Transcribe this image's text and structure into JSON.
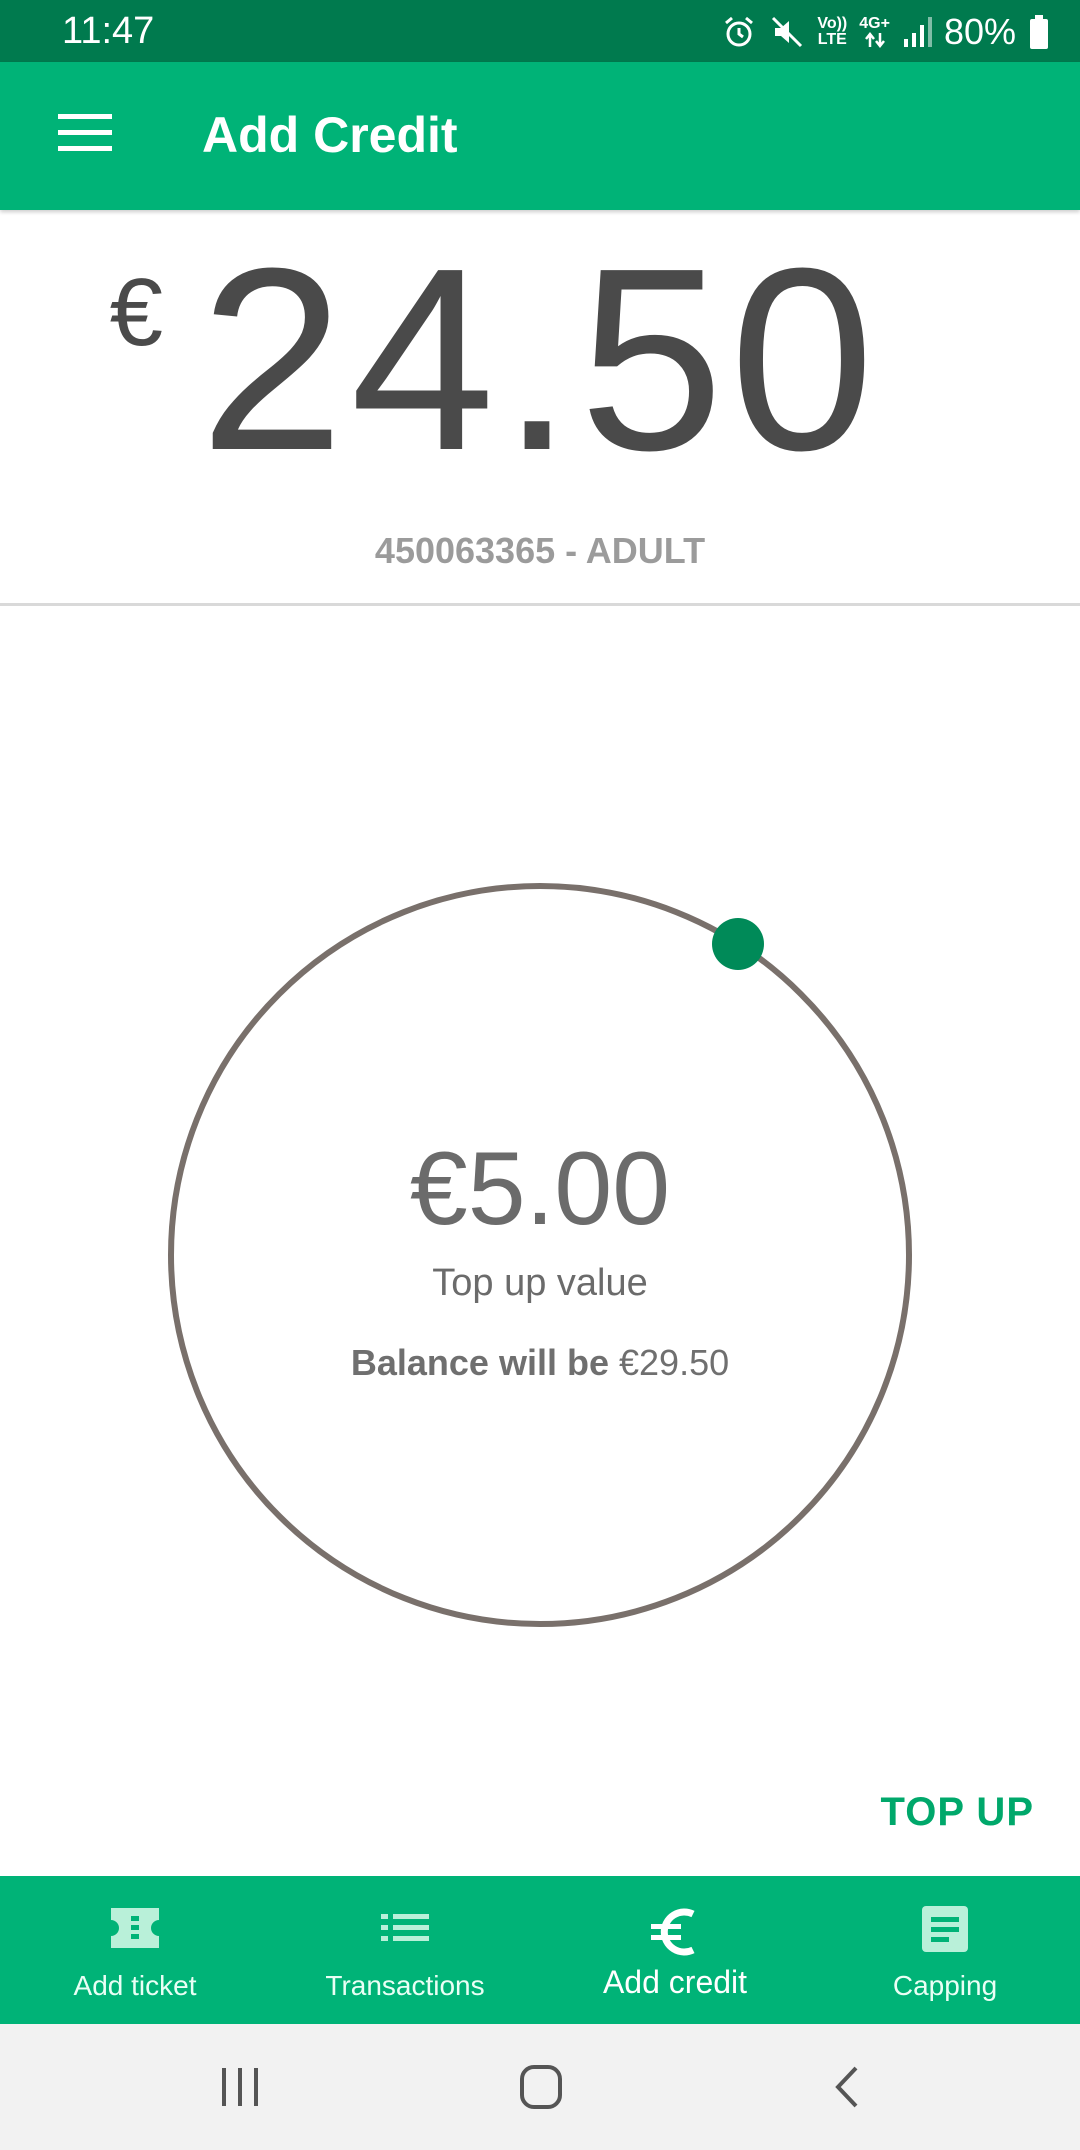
{
  "status": {
    "time": "11:47",
    "volte": "Vo))",
    "lte": "LTE",
    "network": "4G+",
    "battery": "80%"
  },
  "appbar": {
    "title": "Add Credit"
  },
  "balance": {
    "currency": "€",
    "amount": "24.50",
    "card_id": "450063365 - ADULT"
  },
  "dial": {
    "topup_value": "€5.00",
    "topup_label": "Top up value",
    "balance_prefix": "Balance will be",
    "balance_new": "€29.50",
    "track_color": "#79706b",
    "handle_color": "#008a58"
  },
  "actions": {
    "top_up_label": "TOP UP"
  },
  "bottom_nav": {
    "items": [
      {
        "label": "Add ticket",
        "icon": "ticket-icon"
      },
      {
        "label": "Transactions",
        "icon": "list-icon"
      },
      {
        "label": "Add credit",
        "icon": "euro-icon"
      },
      {
        "label": "Capping",
        "icon": "document-icon"
      }
    ],
    "active_index": 2
  },
  "colors": {
    "primary": "#00b377",
    "primary_dark": "#007a4e",
    "accent": "#00a86b"
  }
}
